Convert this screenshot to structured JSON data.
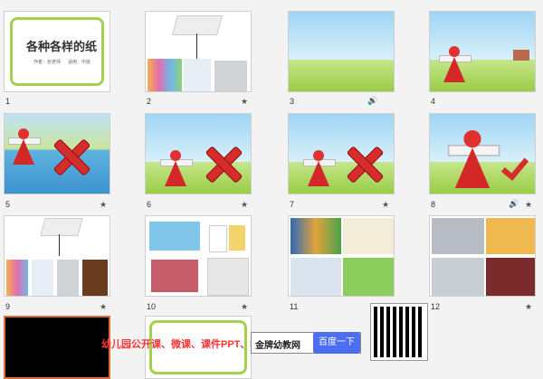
{
  "slides": [
    {
      "num": "1",
      "title": "各种各样的纸",
      "sub": "作者：张老师",
      "sub2": "适用：中班"
    },
    {
      "num": "2"
    },
    {
      "num": "3"
    },
    {
      "num": "4"
    },
    {
      "num": "5"
    },
    {
      "num": "6"
    },
    {
      "num": "7"
    },
    {
      "num": "8"
    },
    {
      "num": "9"
    },
    {
      "num": "10"
    },
    {
      "num": "11"
    },
    {
      "num": "12"
    }
  ],
  "markers": {
    "star": "★",
    "audio": "🔊"
  },
  "banner": {
    "text": "幼儿园公开课、微课、课件PPT、教案",
    "brand": "金牌幼教网",
    "button": "百度一下"
  },
  "colors": {
    "red": "#d62c2c",
    "banner": "#ff3333"
  }
}
